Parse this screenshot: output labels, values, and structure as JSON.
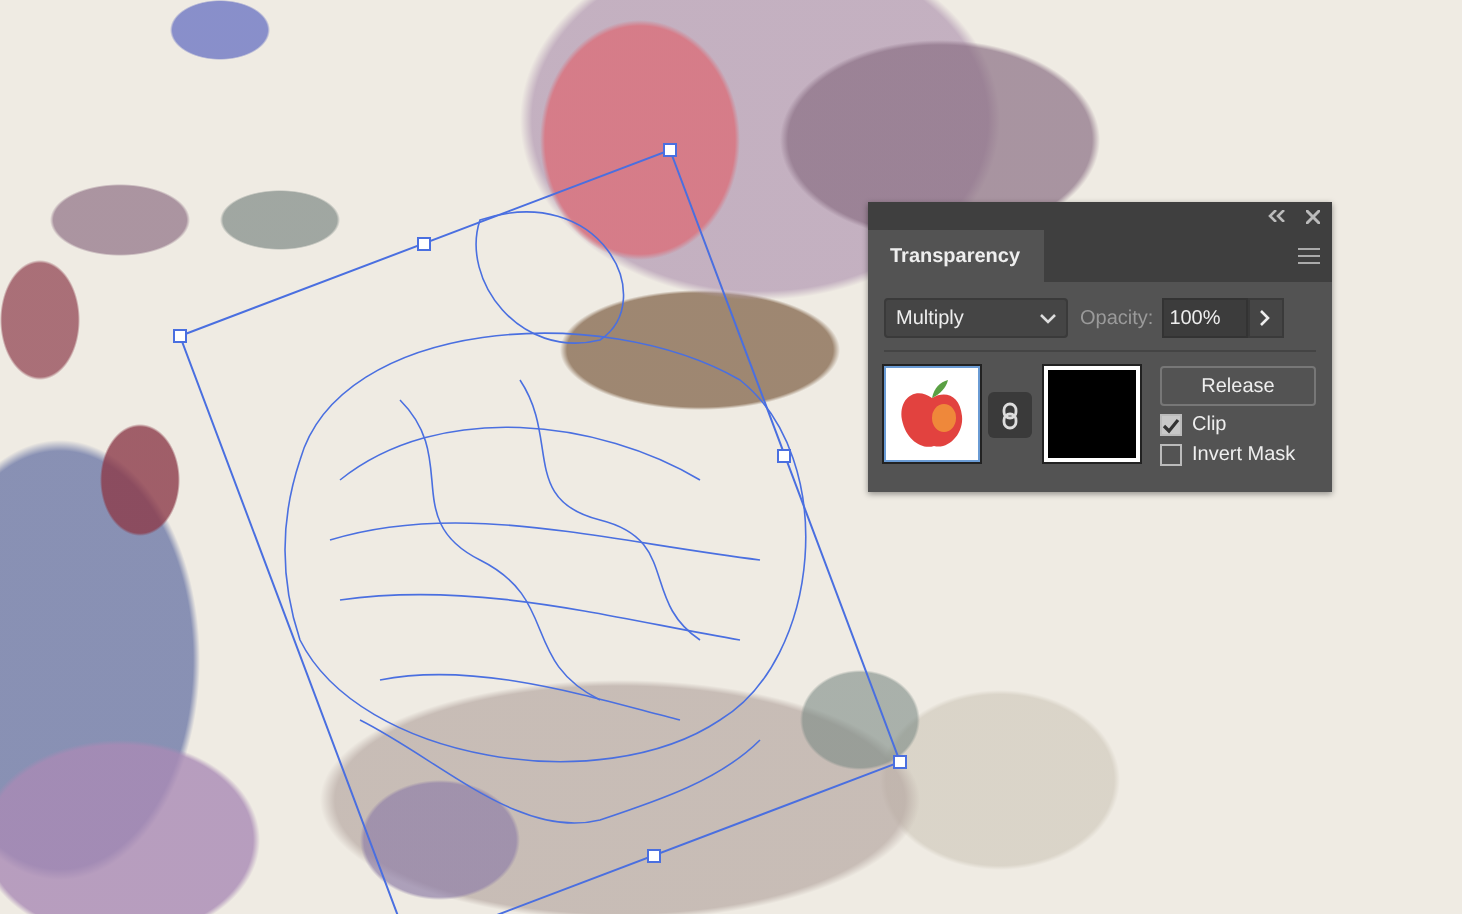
{
  "transparency_panel": {
    "tab": "Transparency",
    "blend_mode": "Multiply",
    "opacity_label": "Opacity:",
    "opacity_value": "100%",
    "release_button": "Release",
    "options": [
      {
        "label": "Clip",
        "checked": true
      },
      {
        "label": "Invert Mask",
        "checked": false
      }
    ]
  }
}
